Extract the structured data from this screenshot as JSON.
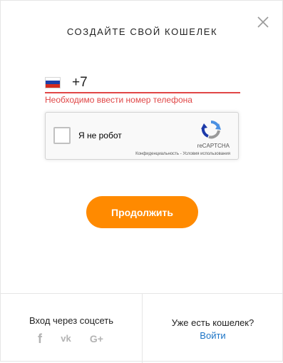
{
  "modal": {
    "title": "СОЗДАЙТЕ СВОЙ КОШЕЛЕК",
    "close_icon": "close-icon"
  },
  "phone": {
    "country_flag": "russia-flag-icon",
    "value": "+7",
    "error": "Необходимо ввести номер телефона",
    "error_color": "#e04646"
  },
  "recaptcha": {
    "checkbox_label": "Я не робот",
    "brand": "reCAPTCHA",
    "privacy": "Конфиденциальность",
    "separator": " - ",
    "terms": "Условия использования"
  },
  "continue_button": {
    "label": "Продолжить",
    "color": "#ff8a00"
  },
  "footer": {
    "social_label": "Вход через соцсеть",
    "social_icons": [
      "facebook-icon",
      "vk-icon",
      "google-plus-icon"
    ],
    "facebook_glyph": "f",
    "vk_glyph": "vk",
    "google_glyph": "G+",
    "have_wallet": "Уже есть кошелек?",
    "login_link": "Войти",
    "link_color": "#1a73c6"
  }
}
